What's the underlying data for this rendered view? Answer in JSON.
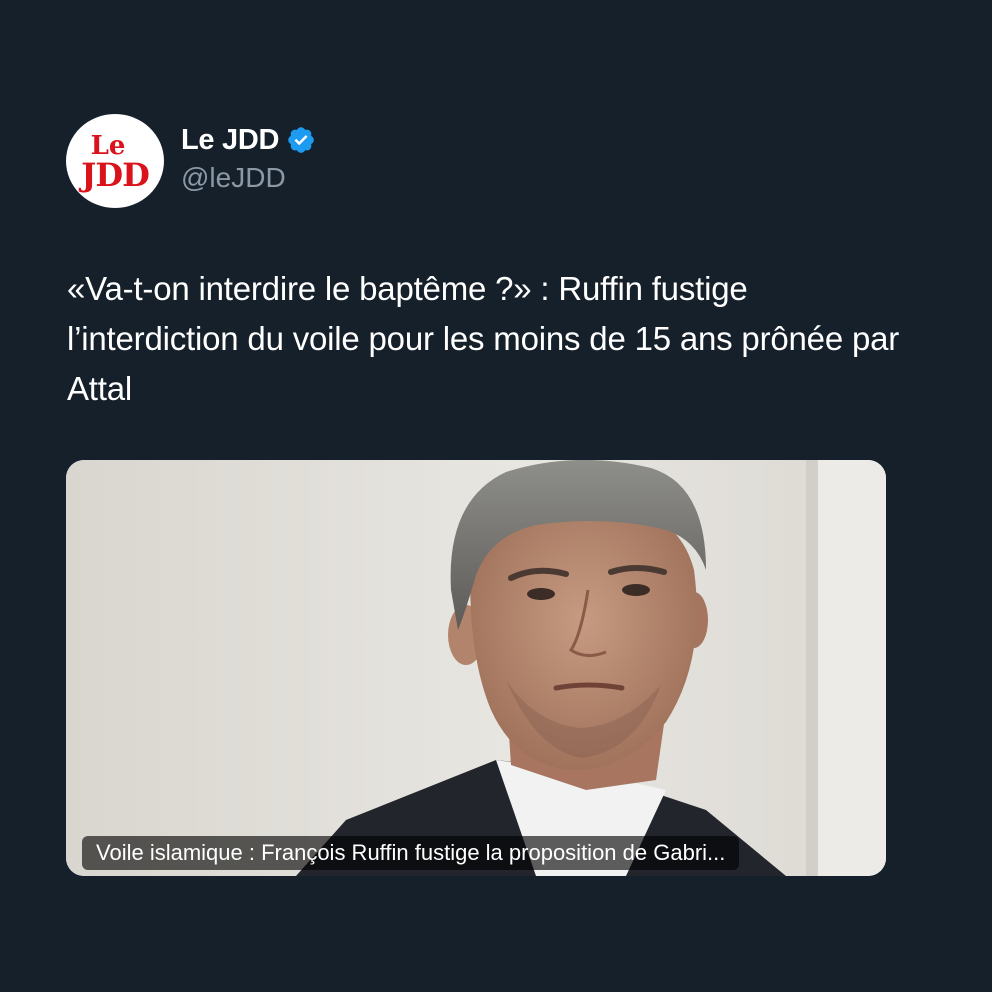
{
  "tweet": {
    "author": {
      "display_name": "Le JDD",
      "handle": "@leJDD",
      "verified": true,
      "verified_color": "#1d9bf0",
      "avatar": {
        "logo_line1": "Le",
        "logo_line2": "JDD",
        "logo_color": "#d9121b",
        "background": "#ffffff"
      }
    },
    "text": "«Va-t-on interdire le baptême ?» : Ruffin fustige l’interdiction du voile pour les moins de 15 ans prônée par Attal",
    "media": {
      "caption": "Voile islamique : François Ruffin fustige la proposition de Gabri..."
    }
  },
  "colors": {
    "background": "#15202b",
    "text_primary": "#ffffff",
    "text_secondary": "#8b98a5"
  }
}
